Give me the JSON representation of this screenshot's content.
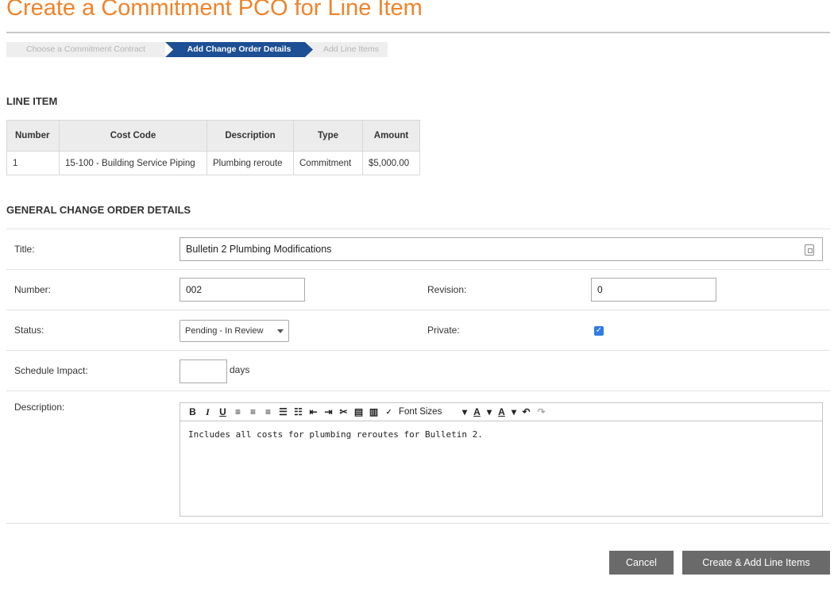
{
  "page": {
    "title": "Create a Commitment PCO for Line Item"
  },
  "steps": [
    {
      "label": "Choose a Commitment Contract",
      "state": "done"
    },
    {
      "label": "Add Change Order Details",
      "state": "active"
    },
    {
      "label": "Add Line Items",
      "state": "pending"
    }
  ],
  "line_item": {
    "heading": "LINE ITEM",
    "columns": [
      "Number",
      "Cost Code",
      "Description",
      "Type",
      "Amount"
    ],
    "rows": [
      [
        "1",
        "15-100 - Building Service Piping",
        "Plumbing reroute",
        "Commitment",
        "$5,000.00"
      ]
    ]
  },
  "details": {
    "heading": "GENERAL CHANGE ORDER DETAILS",
    "title_label": "Title:",
    "title_value": "Bulletin 2 Plumbing Modifications",
    "number_label": "Number:",
    "number_value": "002",
    "revision_label": "Revision:",
    "revision_value": "0",
    "status_label": "Status:",
    "status_value": "Pending - In Review",
    "private_label": "Private:",
    "private_checked": true,
    "schedule_label": "Schedule Impact:",
    "schedule_value": "",
    "schedule_unit": "days",
    "description_label": "Description:",
    "description_value": "Includes all costs for plumbing reroutes for Bulletin 2."
  },
  "editor_toolbar": {
    "bold": "B",
    "italic": "I",
    "underline": "U",
    "font_sizes": "Font Sizes",
    "font_color": "A",
    "highlight": "A",
    "icons": [
      "bold-icon",
      "italic-icon",
      "underline-icon",
      "align-left-icon",
      "align-center-icon",
      "align-right-icon",
      "bullet-list-icon",
      "numbered-list-icon",
      "outdent-icon",
      "indent-icon",
      "cut-icon",
      "paste-icon",
      "paste-text-icon",
      "spellcheck-icon",
      "undo-icon",
      "redo-icon"
    ]
  },
  "actions": {
    "cancel": "Cancel",
    "create": "Create & Add Line Items"
  },
  "colors": {
    "title_orange": "#f0832a",
    "step_active": "#1d4f94",
    "button_gray": "#6a6a6a",
    "checkbox_blue": "#2f7ce6"
  }
}
